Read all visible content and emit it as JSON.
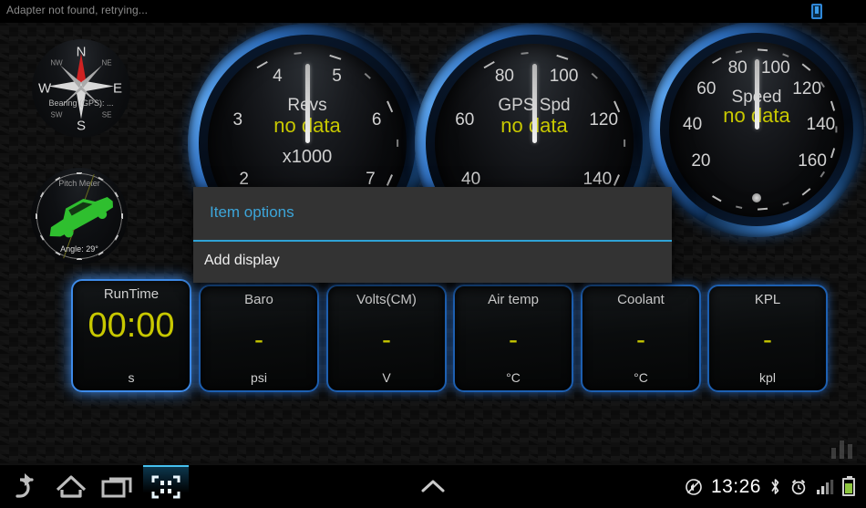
{
  "app": {
    "status_text": "Adapter not found, retrying...",
    "status_icon": "device-icon",
    "overlay_icon": "equalizer-icon",
    "accent_blue": "#2f7fd8",
    "value_yellow": "#c8c800",
    "dialog_cyan": "#3ca5d9"
  },
  "compass": {
    "name": "compass-widget",
    "cardinals": [
      "N",
      "E",
      "S",
      "W"
    ],
    "ordinals": [
      "NW",
      "NE",
      "SE",
      "SW"
    ],
    "bearing_label": "Bearing (GPS): ..."
  },
  "pitch": {
    "name": "pitch-meter-widget",
    "title": "Pitch Meter",
    "angle_label": "Angle: 29°",
    "car_color": "#2fbf2f"
  },
  "gauges": [
    {
      "id": "revs",
      "title": "Revs",
      "value": "no data",
      "sub": "x1000",
      "ticks": [
        "2",
        "3",
        "4",
        "5",
        "6",
        "7"
      ],
      "min": 2,
      "max": 7,
      "needle_value": 0
    },
    {
      "id": "gps-speed",
      "title": "GPS Spd",
      "value": "no data",
      "sub": "",
      "ticks": [
        "40",
        "60",
        "80",
        "100",
        "120",
        "140"
      ],
      "min": 40,
      "max": 140,
      "needle_value": 0
    },
    {
      "id": "speed",
      "title": "Speed",
      "value": "no data",
      "sub": "",
      "ticks": [
        "20",
        "40",
        "60",
        "80",
        "100",
        "120",
        "140",
        "160"
      ],
      "min": 20,
      "max": 160,
      "needle_value": 0
    }
  ],
  "tiles": [
    {
      "id": "runtime",
      "name": "RunTime",
      "value": "00:00",
      "unit": "s",
      "selected": true
    },
    {
      "id": "baro",
      "name": "Baro",
      "value": "-",
      "unit": "psi",
      "selected": false
    },
    {
      "id": "volts",
      "name": "Volts(CM)",
      "value": "-",
      "unit": "V",
      "selected": false
    },
    {
      "id": "airtemp",
      "name": "Air temp",
      "value": "-",
      "unit": "°C",
      "selected": false
    },
    {
      "id": "coolant",
      "name": "Coolant",
      "value": "-",
      "unit": "°C",
      "selected": false
    },
    {
      "id": "kpl",
      "name": "KPL",
      "value": "-",
      "unit": "kpl",
      "selected": false
    }
  ],
  "dialog": {
    "title": "Item options",
    "items": [
      {
        "label": "Add display"
      }
    ]
  },
  "navbar": {
    "buttons": [
      {
        "id": "back",
        "icon": "back-arrow-icon",
        "active": false
      },
      {
        "id": "home",
        "icon": "home-icon",
        "active": false
      },
      {
        "id": "recents",
        "icon": "recents-icon",
        "active": false
      },
      {
        "id": "screenshot",
        "icon": "screenshot-icon",
        "active": true
      }
    ],
    "expand_icon": "expand-up-icon",
    "status": {
      "mute_icon": "silent-mode-icon",
      "clock": "13:26",
      "bluetooth_icon": "bluetooth-icon",
      "alarm_icon": "alarm-icon",
      "signal_icon": "signal-bars-icon",
      "battery_icon": "battery-icon"
    }
  }
}
